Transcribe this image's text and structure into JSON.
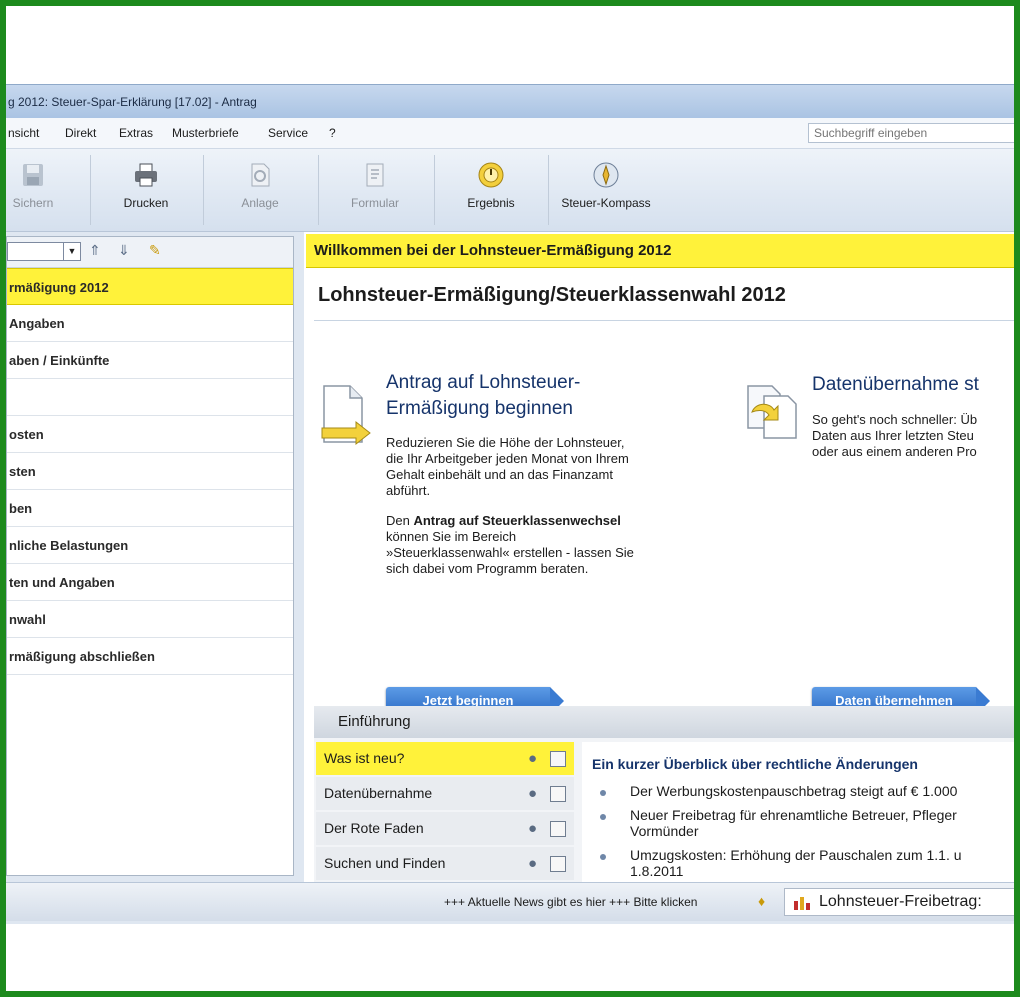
{
  "window": {
    "title": "g 2012: Steuer-Spar-Erklärung [17.02] - Antrag"
  },
  "menu": [
    "nsicht",
    "Direkt",
    "Extras",
    "Musterbriefe",
    "Service",
    "?"
  ],
  "search": {
    "placeholder": "Suchbegriff eingeben"
  },
  "toolbar": {
    "buttons": [
      {
        "label": "Sichern",
        "icon": "save-icon",
        "enabled": false
      },
      {
        "label": "Drucken",
        "icon": "printer-icon",
        "enabled": true
      },
      {
        "label": "Anlage",
        "icon": "attachment-icon",
        "enabled": false
      },
      {
        "label": "Formular",
        "icon": "form-icon",
        "enabled": false
      },
      {
        "label": "Ergebnis",
        "icon": "result-icon",
        "enabled": true
      },
      {
        "label": "Steuer-Kompass",
        "icon": "compass-icon",
        "enabled": true
      }
    ]
  },
  "sidebar": {
    "items": [
      {
        "label": "rmäßigung 2012",
        "active": true
      },
      {
        "label": "Angaben"
      },
      {
        "label": "aben / Einkünfte"
      },
      {
        "label": ""
      },
      {
        "label": "osten"
      },
      {
        "label": "sten"
      },
      {
        "label": "ben"
      },
      {
        "label": "nliche Belastungen"
      },
      {
        "label": "ten und Angaben"
      },
      {
        "label": "nwahl"
      },
      {
        "label": "rmäßigung abschließen"
      }
    ]
  },
  "main": {
    "welcome": "Willkommen bei der Lohnsteuer-Ermäßigung 2012",
    "title": "Lohnsteuer-Ermäßigung/Steuerklassenwahl 2012",
    "card1": {
      "head_line1": "Antrag auf Lohnsteuer-",
      "head_line2": "Ermäßigung beginnen",
      "p1": [
        "Reduzieren Sie die Höhe der Lohnsteuer,",
        "die Ihr Arbeitgeber jeden Monat von Ihrem",
        "Gehalt einbehält und an das Finanzamt",
        "abführt."
      ],
      "p2_prefix": "Den ",
      "p2_bold": "Antrag auf Steuerklassenwechsel",
      "p2_rest": [
        "können Sie im Bereich",
        "»Steuerklassenwahl« erstellen - lassen Sie",
        "sich dabei vom Programm beraten."
      ],
      "button": "Jetzt beginnen"
    },
    "card2": {
      "head": "Datenübernahme st",
      "lines": [
        "So geht's noch schneller: Üb",
        "Daten aus Ihrer letzten Steu",
        "oder aus einem anderen Pro"
      ],
      "button": "Daten übernehmen"
    },
    "intro": {
      "header": "Einführung",
      "items": [
        {
          "label": "Was ist neu?",
          "active": true
        },
        {
          "label": "Datenübernahme"
        },
        {
          "label": "Der Rote Faden"
        },
        {
          "label": "Suchen und Finden"
        }
      ],
      "news_head": "Ein kurzer Überblick über rechtliche Änderungen",
      "news": [
        [
          "Der Werbungskostenpauschbetrag steigt auf € 1.000"
        ],
        [
          "Neuer Freibetrag für ehrenamtliche Betreuer, Pfleger",
          "Vormünder"
        ],
        [
          "Umzugskosten: Erhöhung der Pauschalen zum 1.1. u",
          "1.8.2011"
        ]
      ]
    }
  },
  "status": {
    "news": "+++ Aktuelle News gibt es hier +++ Bitte klicken",
    "box": "Lohnsteuer-Freibetrag:"
  },
  "colors": {
    "highlight": "#fff23a",
    "frame": "#1d8a1d",
    "button": "#2c6bc4",
    "heading": "#16346b"
  }
}
